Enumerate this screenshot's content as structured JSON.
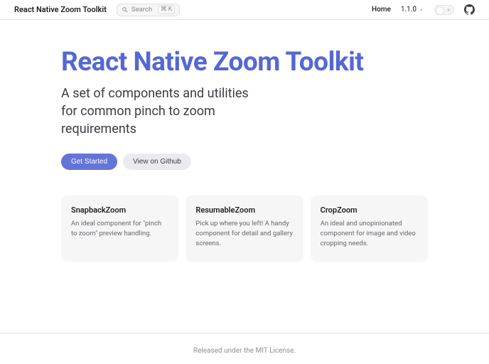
{
  "header": {
    "site_title": "React Native Zoom Toolkit",
    "search_placeholder": "Search",
    "search_shortcut": "⌘ K",
    "nav_home": "Home",
    "version": "1.1.0"
  },
  "hero": {
    "title": "React Native Zoom Toolkit",
    "subtitle": "A set of components and utilities for common pinch to zoom requirements",
    "btn_primary": "Get Started",
    "btn_secondary": "View on Github"
  },
  "features": [
    {
      "title": "SnapbackZoom",
      "desc": "An ideal component for \"pinch to zoom\" preview handling."
    },
    {
      "title": "ResumableZoom",
      "desc": "Pick up where you left! A handy component for detail and gallery screens."
    },
    {
      "title": "CropZoom",
      "desc": "An ideal and unopinionated component for image and video cropping needs."
    }
  ],
  "footer": {
    "text": "Released under the MIT License."
  }
}
